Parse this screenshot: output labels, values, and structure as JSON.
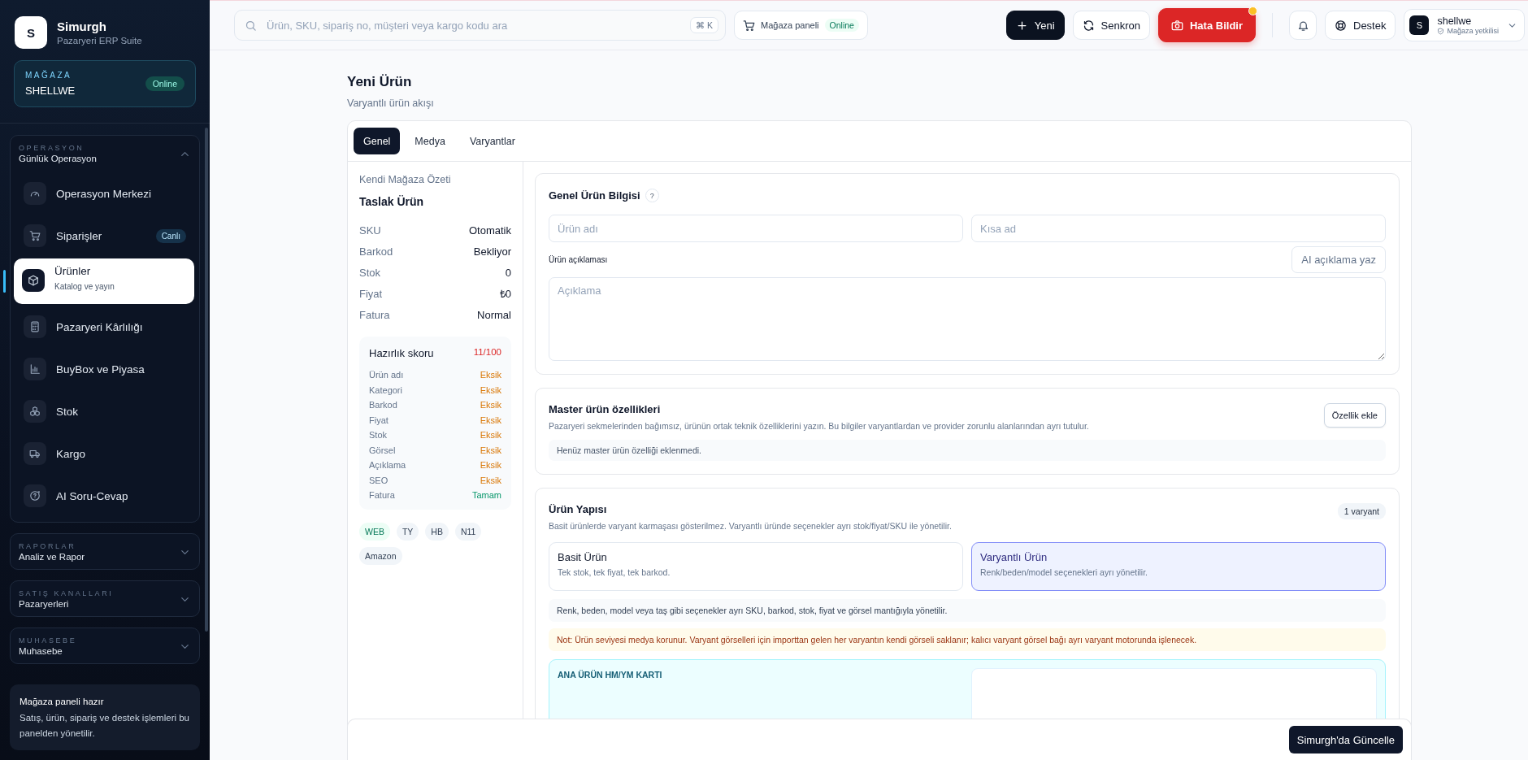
{
  "brand": {
    "initial": "S",
    "name": "Simurgh",
    "subtitle": "Pazaryeri ERP Suite"
  },
  "store": {
    "label": "MAĞAZA",
    "name": "SHELLWE",
    "status": "Online"
  },
  "nav_groups": [
    {
      "label": "OPERASYON",
      "title": "Günlük Operasyon",
      "expanded": true,
      "items": [
        {
          "label": "Operasyon Merkezi",
          "selected": false
        },
        {
          "label": "Siparişler",
          "badge": "Canlı",
          "selected": false
        },
        {
          "label": "Ürünler",
          "sublabel": "Katalog ve yayın",
          "selected": true
        },
        {
          "label": "Pazaryeri Kârlılığı",
          "selected": false
        },
        {
          "label": "BuyBox ve Piyasa",
          "selected": false
        },
        {
          "label": "Stok",
          "selected": false
        },
        {
          "label": "Kargo",
          "selected": false
        },
        {
          "label": "AI Soru-Cevap",
          "selected": false
        }
      ]
    },
    {
      "label": "RAPORLAR",
      "title": "Analiz ve Rapor",
      "expanded": false
    },
    {
      "label": "SATIŞ KANALLARI",
      "title": "Pazaryerleri",
      "expanded": false
    },
    {
      "label": "MUHASEBE",
      "title": "Muhasebe",
      "expanded": false
    }
  ],
  "sidebar_note": {
    "title": "Mağaza paneli hazır",
    "text": "Satış, ürün, sipariş ve destek işlemleri bu panelden yönetilir."
  },
  "search": {
    "placeholder": "Ürün, SKU, sipariş no, müşteri veya kargo kodu ara",
    "shortcut": "⌘ K"
  },
  "store_panel": {
    "label": "Mağaza paneli",
    "status": "Online"
  },
  "actions": [
    {
      "label": "Yeni",
      "kind": "primary",
      "alert": false
    },
    {
      "label": "Senkron",
      "kind": "default",
      "alert": false
    },
    {
      "label": "Hata Bildir",
      "kind": "danger",
      "alert": true
    }
  ],
  "support": {
    "label": "Destek"
  },
  "user": {
    "initial": "S",
    "name": "shellwe",
    "role": "Mağaza yetkilisi"
  },
  "page": {
    "title": "Yeni Ürün",
    "subtitle": "Varyantlı ürün akışı"
  },
  "tabs": [
    {
      "label": "Genel",
      "selected": true
    },
    {
      "label": "Medya",
      "selected": false
    },
    {
      "label": "Varyantlar",
      "selected": false
    }
  ],
  "summary": {
    "heading": "Kendi Mağaza Özeti",
    "title": "Taslak Ürün",
    "fields": [
      {
        "label": "SKU",
        "value": "Otomatik"
      },
      {
        "label": "Barkod",
        "value": "Bekliyor"
      },
      {
        "label": "Stok",
        "value": "0"
      },
      {
        "label": "Fiyat",
        "value": "₺0"
      },
      {
        "label": "Fatura",
        "value": "Normal"
      }
    ],
    "score": {
      "label": "Hazırlık skoru",
      "value": "11/100",
      "checks": [
        {
          "label": "Ürün adı",
          "status": "Eksik",
          "kind": "missing"
        },
        {
          "label": "Kategori",
          "status": "Eksik",
          "kind": "missing"
        },
        {
          "label": "Barkod",
          "status": "Eksik",
          "kind": "missing"
        },
        {
          "label": "Fiyat",
          "status": "Eksik",
          "kind": "missing"
        },
        {
          "label": "Stok",
          "status": "Eksik",
          "kind": "missing"
        },
        {
          "label": "Görsel",
          "status": "Eksik",
          "kind": "missing"
        },
        {
          "label": "Açıklama",
          "status": "Eksik",
          "kind": "missing"
        },
        {
          "label": "SEO",
          "status": "Eksik",
          "kind": "missing"
        },
        {
          "label": "Fatura",
          "status": "Tamam",
          "kind": "ok"
        }
      ]
    },
    "channels": [
      {
        "label": "WEB",
        "active": true
      },
      {
        "label": "TY",
        "active": false
      },
      {
        "label": "HB",
        "active": false
      },
      {
        "label": "N11",
        "active": false
      },
      {
        "label": "Amazon",
        "active": false
      }
    ]
  },
  "general": {
    "title": "Genel Ürün Bilgisi",
    "help": "?",
    "name_placeholder": "Ürün adı",
    "short_placeholder": "Kısa ad",
    "description_label": "Ürün açıklaması",
    "ai_button": "AI açıklama yaz",
    "description_placeholder": "Açıklama"
  },
  "master": {
    "title": "Master ürün özellikleri",
    "text": "Pazaryeri sekmelerinden bağımsız, ürünün ortak teknik özelliklerini yazın. Bu bilgiler varyantlardan ve provider zorunlu alanlarından ayrı tutulur.",
    "button": "Özellik ekle",
    "empty": "Henüz master ürün özelliği eklenmedi."
  },
  "structure": {
    "title": "Ürün Yapısı",
    "badge": "1 varyant",
    "text": "Basit ürünlerde varyant karmaşası gösterilmez. Varyantlı üründe seçenekler ayrı stok/fiyat/SKU ile yönetilir.",
    "options": [
      {
        "title": "Basit Ürün",
        "text": "Tek stok, tek fiyat, tek barkod.",
        "selected": false
      },
      {
        "title": "Varyantlı Ürün",
        "text": "Renk/beden/model seçenekleri ayrı yönetilir.",
        "selected": true
      }
    ],
    "info": "Renk, beden, model veya taş gibi seçenekler ayrı SKU, barkod, stok, fiyat ve görsel mantığıyla yönetilir.",
    "note": "Not: Ürün seviyesi medya korunur. Varyant görselleri için importtan gelen her varyantın kendi görseli saklanır; kalıcı varyant görsel bağı ayrı varyant motorunda işlenecek.",
    "card_title": "ANA ÜRÜN HM/YM KARTI"
  },
  "footer": {
    "button": "Simurgh'da Güncelle"
  }
}
